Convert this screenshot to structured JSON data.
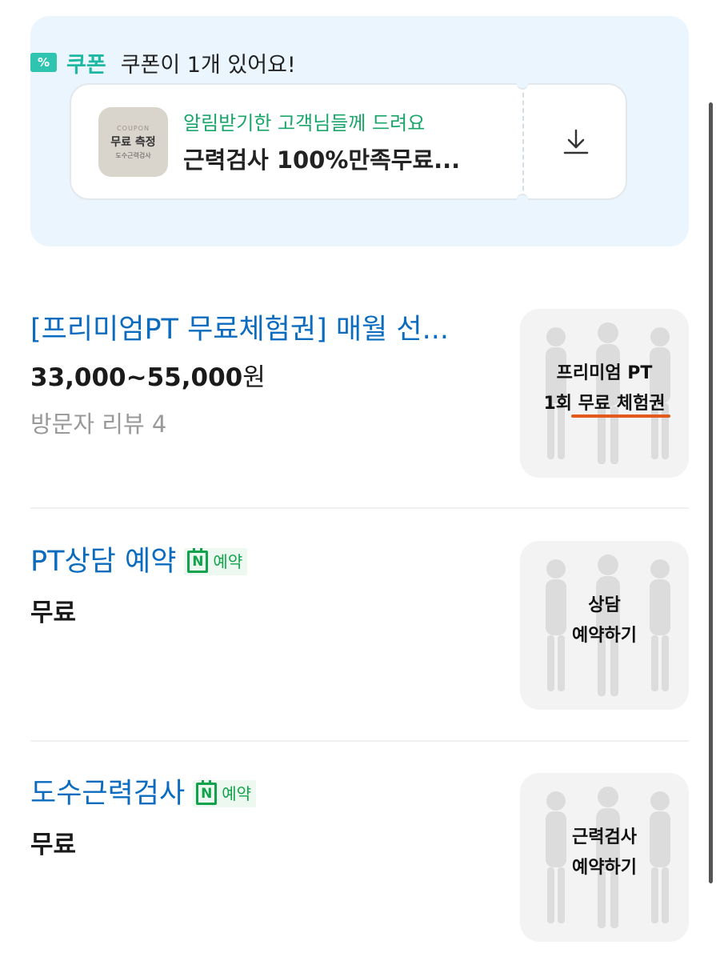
{
  "coupon": {
    "tag_icon": "%",
    "title": "쿠폰",
    "count_text": "쿠폰이 1개 있어요!",
    "card": {
      "thumb_line1": "COUPON",
      "thumb_line2": "무료 측정",
      "thumb_line3": "도수근력검사",
      "subtitle": "알림받기한 고객님들께 드려요",
      "name": "근력검사 100%만족무료...",
      "download_icon": "download-icon"
    }
  },
  "items": [
    {
      "title": "[프리미엄PT 무료체험권] 매월 선...",
      "price": "33,000~55,000",
      "price_unit": "원",
      "review": "방문자 리뷰 4",
      "thumb_line1": "프리미엄 PT",
      "thumb_line2": "1회 무료 체험권"
    },
    {
      "title": "PT상담 예약",
      "badge_letter": "N",
      "badge_label": "예약",
      "price": "무료",
      "thumb_line1": "상담",
      "thumb_line2": "예약하기"
    },
    {
      "title": "도수근력검사",
      "badge_letter": "N",
      "badge_label": "예약",
      "price": "무료",
      "thumb_line1": "근력검사",
      "thumb_line2": "예약하기"
    }
  ],
  "colors": {
    "accent_teal": "#1fb8a3",
    "link_blue": "#0b6cbf",
    "naver_green": "#11a34b",
    "coupon_bg": "#eaf5fd"
  }
}
